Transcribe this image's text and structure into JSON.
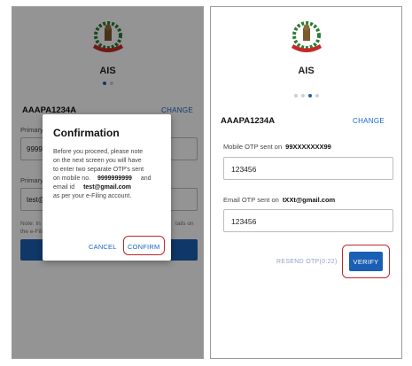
{
  "left_screen": {
    "app_title": "AIS",
    "pan": "AAAPA1234A",
    "change_label": "CHANGE",
    "primary_mobile_label": "Primary",
    "primary_mobile_value": "9999",
    "primary_email_label": "Primary",
    "primary_email_value": "test@",
    "note_left": "Note: In",
    "note_left2": "the e-Filing",
    "note_right": "tails on",
    "dialog": {
      "title": "Confirmation",
      "line1": "Before you proceed, please note",
      "line2": "on the next screen you will have",
      "line3": "to enter two separate OTP's sent",
      "line4_prefix": "on mobile no.",
      "mobile": "9999999999",
      "line4_suffix": "and",
      "line5_prefix": "email id",
      "email": "test@gmail.com",
      "line6": "as   per your e-Filing account.",
      "cancel_label": "CANCEL",
      "confirm_label": "CONFIRM"
    }
  },
  "right_screen": {
    "app_title": "AIS",
    "pan": "AAAPA1234A",
    "change_label": "CHANGE",
    "mobile_otp_label": "Mobile OTP sent on",
    "mobile_masked": "99XXXXXXX99",
    "mobile_otp_value": "123456",
    "email_otp_label": "Email OTP sent on",
    "email_masked": "tXXt@gmail.com",
    "email_otp_value": "123456",
    "resend_label": "RESEND OTP(0:22)",
    "verify_label": "VERIFY"
  },
  "colors": {
    "accent": "#1a5fb4",
    "highlight": "#c1272d",
    "logo_green": "#2e7d32",
    "logo_red": "#c62828"
  }
}
